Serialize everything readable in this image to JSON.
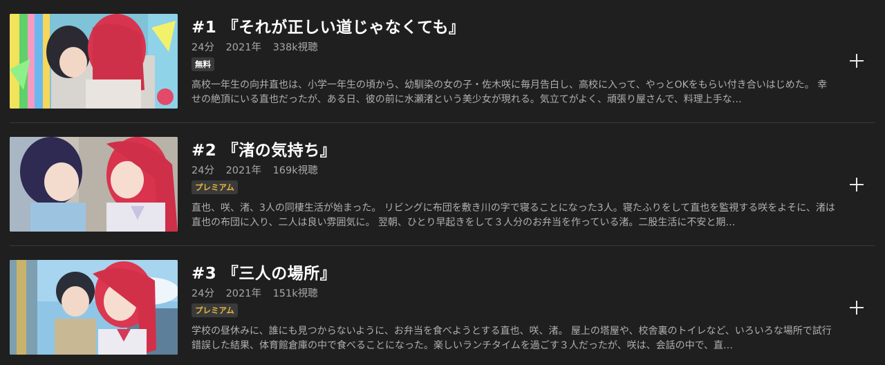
{
  "episodes": [
    {
      "title": "#1 『それが正しい道じゃなくても』",
      "duration": "24分",
      "year": "2021年",
      "views": "338k視聴",
      "badge": "無料",
      "badge_type": "free",
      "description": "高校一年生の向井直也は、小学一年生の頃から、幼馴染の女の子・佐木咲に毎月告白し、高校に入って、やっとOKをもらい付き合いはじめた。 幸せの絶頂にいる直也だったが、ある日、彼の前に水瀬渚という美少女が現れる。気立てがよく、頑張り屋さんで、料理上手な…",
      "add_icon": "plus-icon"
    },
    {
      "title": "#2 『渚の気持ち』",
      "duration": "24分",
      "year": "2021年",
      "views": "169k視聴",
      "badge": "プレミアム",
      "badge_type": "premium",
      "description": "直也、咲、渚、3人の同棲生活が始まった。 リビングに布団を敷き川の字で寝ることになった3人。寝たふりをして直也を監視する咲をよそに、渚は直也の布団に入り、二人は良い雰囲気に。 翌朝、ひとり早起きをして３人分のお弁当を作っている渚。二股生活に不安と期…",
      "add_icon": "plus-icon"
    },
    {
      "title": "#3 『三人の場所』",
      "duration": "24分",
      "year": "2021年",
      "views": "151k視聴",
      "badge": "プレミアム",
      "badge_type": "premium",
      "description": "学校の昼休みに、誰にも見つからないように、お弁当を食べようとする直也、咲、渚。 屋上の塔屋や、校舎裏のトイレなど、いろいろな場所で試行錯誤した結果、体育館倉庫の中で食べることになった。楽しいランチタイムを過ごす３人だったが、咲は、会話の中で、直…",
      "add_icon": "plus-icon"
    }
  ],
  "colors": {
    "background": "#1f1f1f",
    "premium": "#e9b83a",
    "badge_bg": "#3a3a3a"
  }
}
